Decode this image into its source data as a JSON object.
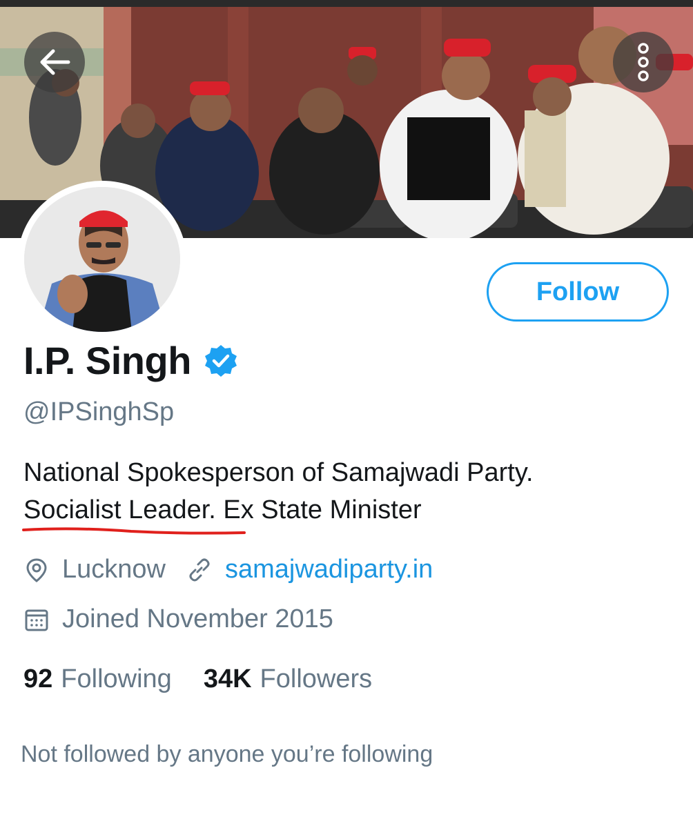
{
  "profile": {
    "name": "I.P. Singh",
    "handle": "@IPSinghSp",
    "bio_line1": "National Spokesperson of Samajwadi Party.",
    "bio_line2": "Socialist Leader. Ex State Minister",
    "location": "Lucknow",
    "website": "samajwadiparty.in",
    "joined": "Joined November 2015",
    "following_count": "92",
    "following_label": "Following",
    "followers_count": "34K",
    "followers_label": "Followers",
    "followed_by_note": "Not followed by anyone you’re following"
  },
  "actions": {
    "follow_label": "Follow"
  },
  "icons": {
    "back": "arrow-left-icon",
    "more": "more-vertical-icon",
    "verified": "verified-badge-icon",
    "location": "location-pin-icon",
    "link": "link-icon",
    "calendar": "calendar-icon"
  },
  "colors": {
    "accent": "#1da1f2",
    "link": "#1b95e0",
    "muted": "#657786",
    "annotation": "#e0201c"
  }
}
